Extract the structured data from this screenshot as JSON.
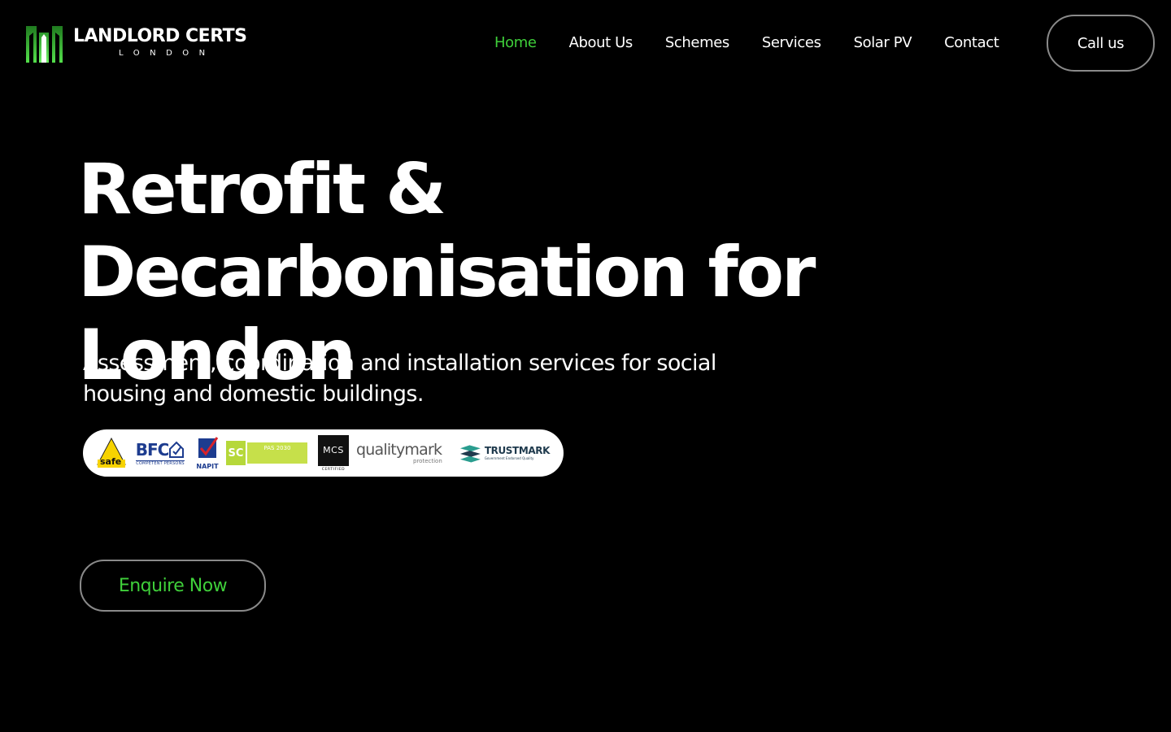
{
  "header": {
    "logo": {
      "name": "LANDLORD CERTS",
      "subtitle": "LONDON",
      "icon": "building-bars-icon",
      "accent_color": "#3fcf3a"
    },
    "nav": [
      {
        "label": "Home",
        "active": true
      },
      {
        "label": "About Us",
        "active": false
      },
      {
        "label": "Schemes",
        "active": false
      },
      {
        "label": "Services",
        "active": false
      },
      {
        "label": "Solar PV",
        "active": false
      },
      {
        "label": "Contact",
        "active": false
      }
    ],
    "call_button": "Call us"
  },
  "hero": {
    "title": "Retrofit & Decarbonisation for London",
    "subtitle": "Assessment, coordination and installation services for social housing and domestic buildings.",
    "accreditations": {
      "gas_safe": "safe",
      "bfc": {
        "name": "BFC",
        "tagline": "COMPETENT PERSONS"
      },
      "napit": "NAPIT",
      "sc": {
        "name": "SC",
        "tag": "PAS 2030"
      },
      "mcs": {
        "name": "MCS",
        "tagline": "CERTIFIED"
      },
      "qualitymark": {
        "name": "qualitymark",
        "tagline": "protection"
      },
      "trustmark": {
        "name": "TRUSTMARK",
        "tagline": "Government Endorsed Quality"
      }
    },
    "cta": "Enquire Now"
  },
  "colors": {
    "background": "#000000",
    "text": "#ffffff",
    "accent": "#3fcf3a",
    "button_border": "#8a8a8a"
  }
}
